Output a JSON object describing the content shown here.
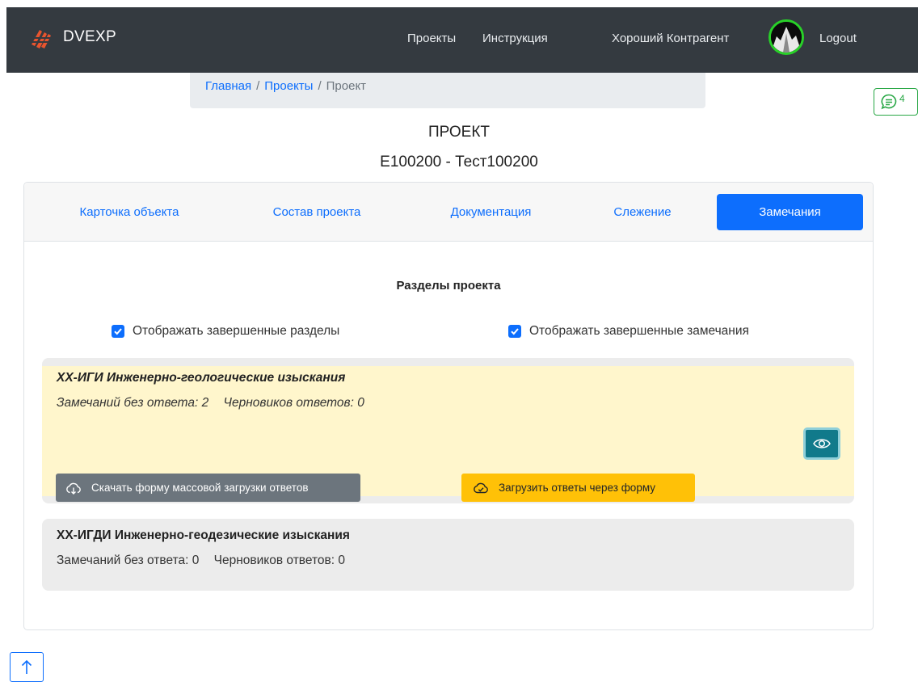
{
  "navbar": {
    "brand": "DVEXP",
    "links": [
      "Проекты",
      "Инструкция"
    ],
    "user": "Хороший Контрагент",
    "logout": "Logout"
  },
  "breadcrumb": {
    "home": "Главная",
    "projects": "Проекты",
    "current": "Проект",
    "separator": "/"
  },
  "chat": {
    "count": "4"
  },
  "page": {
    "title": "ПРОЕКТ",
    "subtitle": "E100200 - Тест100200"
  },
  "tabs": [
    "Карточка объекта",
    "Состав проекта",
    "Документация",
    "Слежение",
    "Замечания"
  ],
  "active_tab": "Замечания",
  "sections_title": "Разделы проекта",
  "checks": {
    "show_completed_sections": "Отображать завершенные разделы",
    "show_completed_remarks": "Отображать завершенные замечания"
  },
  "sections": [
    {
      "title": "ХХ-ИГИ Инженерно-геологические изыскания",
      "unanswered": "Замечаний без ответа: 2",
      "drafts": "Черновиков ответов: 0",
      "download_btn": "Скачать форму массовой загрузки ответов",
      "upload_btn": "Загрузить ответы через форму"
    },
    {
      "title": "ХХ-ИГДИ Инженерно-геодезические изыскания",
      "unanswered": "Замечаний без ответа: 0",
      "drafts": "Черновиков ответов: 0"
    }
  ],
  "colors": {
    "navbar": "#343a40",
    "primary": "#0d6efd",
    "warning_bg": "#fff6cc",
    "warning_btn": "#ffc107",
    "secondary_btn": "#6c757d",
    "info_btn": "#117a8b",
    "success": "#28a745"
  }
}
